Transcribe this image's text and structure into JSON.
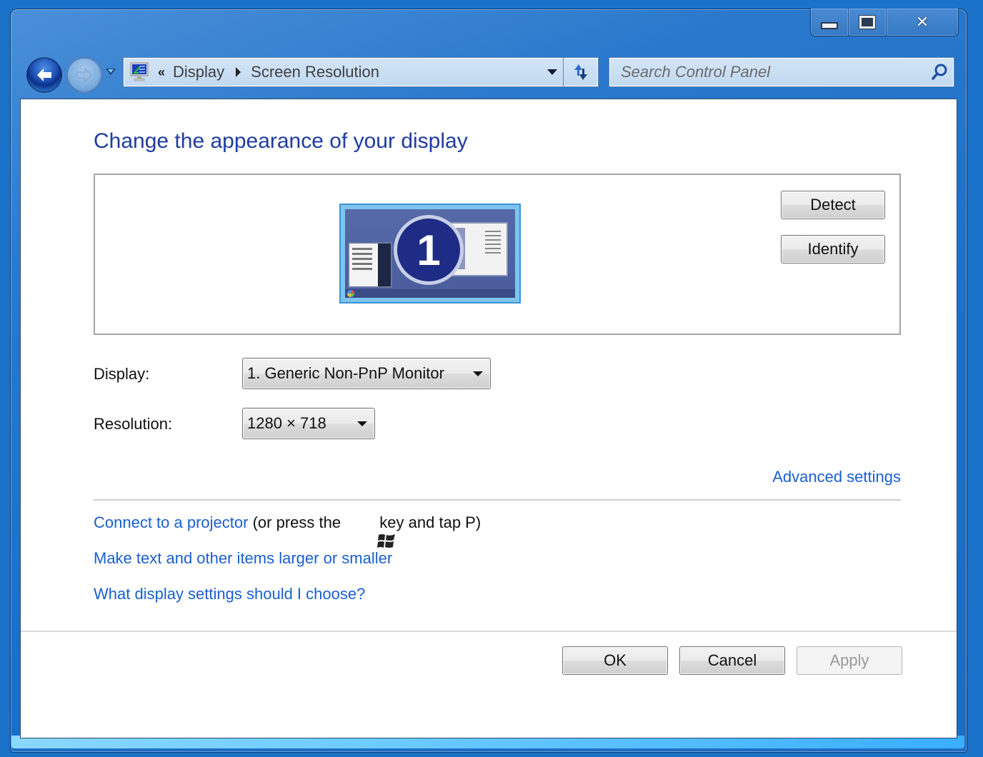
{
  "window": {
    "caption_buttons": {
      "minimize": "minimize",
      "maximize": "maximize",
      "close": "close"
    }
  },
  "nav": {
    "back_icon": "back-arrow-icon",
    "forward_icon": "forward-arrow-icon",
    "history_icon": "chevron-down-icon"
  },
  "address_bar": {
    "icon": "display-control-panel-icon",
    "overflow_glyph": "«",
    "crumbs": [
      "Display",
      "Screen Resolution"
    ],
    "refresh_icon": "refresh-icon"
  },
  "search": {
    "placeholder": "Search Control Panel",
    "value": ""
  },
  "page": {
    "title": "Change the appearance of your display",
    "monitor_number": "1",
    "detect_label": "Detect",
    "identify_label": "Identify",
    "display_label": "Display:",
    "display_value": "1. Generic Non-PnP Monitor",
    "resolution_label": "Resolution:",
    "resolution_value": "1280 × 718",
    "advanced_settings_link": "Advanced settings",
    "projector_link": "Connect to a projector",
    "projector_hint_prefix": " (or press the ",
    "projector_hint_suffix": " key and tap P)",
    "text_size_link": "Make text and other items larger or smaller",
    "what_settings_link": "What display settings should I choose?"
  },
  "footer": {
    "ok_label": "OK",
    "cancel_label": "Cancel",
    "apply_label": "Apply",
    "apply_enabled": false
  },
  "colors": {
    "title_blue": "#1e3d9e",
    "link_blue": "#1a5fd0",
    "frame_blue": "#1d6fc6"
  }
}
